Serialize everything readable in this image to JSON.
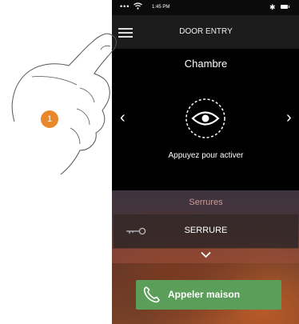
{
  "status_bar": {
    "dots": "•••",
    "time": "1:45 PM"
  },
  "header": {
    "title": "DOOR ENTRY"
  },
  "camera": {
    "name": "Chambre",
    "activate_text": "Appuyez pour activer"
  },
  "locks": {
    "section_title": "Serrures",
    "items": [
      {
        "label": "SERRURE"
      }
    ]
  },
  "call": {
    "label": "Appeler maison"
  },
  "annotation": {
    "step": "1"
  },
  "colors": {
    "accent_green": "#5a9e5a",
    "step_badge": "#e8882b",
    "header_bg": "#1c1c1c"
  }
}
